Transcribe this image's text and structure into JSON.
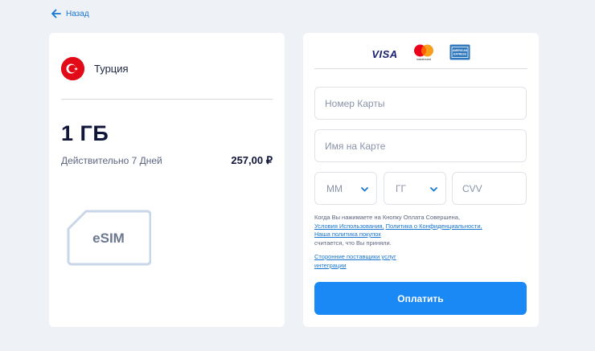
{
  "nav": {
    "back_label": "Назад"
  },
  "product": {
    "country": "Турция",
    "volume": "1 ГБ",
    "validity": "Действительно 7 Дней",
    "price": "257,00 ₽",
    "sim_label": "eSIM"
  },
  "payment": {
    "card_logos": [
      "visa-logo",
      "mastercard-logo",
      "amex-logo"
    ],
    "visa_text": "VISA",
    "mastercard_text": "mastercard",
    "amex_text": "AMERICAN EXPRESS",
    "card_number_placeholder": "Номер Карты",
    "card_name_placeholder": "Имя на Карте",
    "month_placeholder": "ММ",
    "year_placeholder": "ГГ",
    "cvv_placeholder": "CVV",
    "terms_prefix": "Когда Вы нажимаете на Кнопку Оплата Совершена,",
    "terms_link": "Условия Использования,",
    "privacy_link": "Политика о Конфиденциальности,",
    "purchase_policy_link": "Наша политика покупок",
    "terms_suffix": "считается, что Вы приняли.",
    "third_party_link": "Сторонние поставщики услуг интеграции",
    "pay_button": "Оплатить"
  },
  "colors": {
    "accent": "#1a88f5",
    "link": "#1976d2",
    "flag": "#e30a17",
    "background": "#eef1f6"
  }
}
